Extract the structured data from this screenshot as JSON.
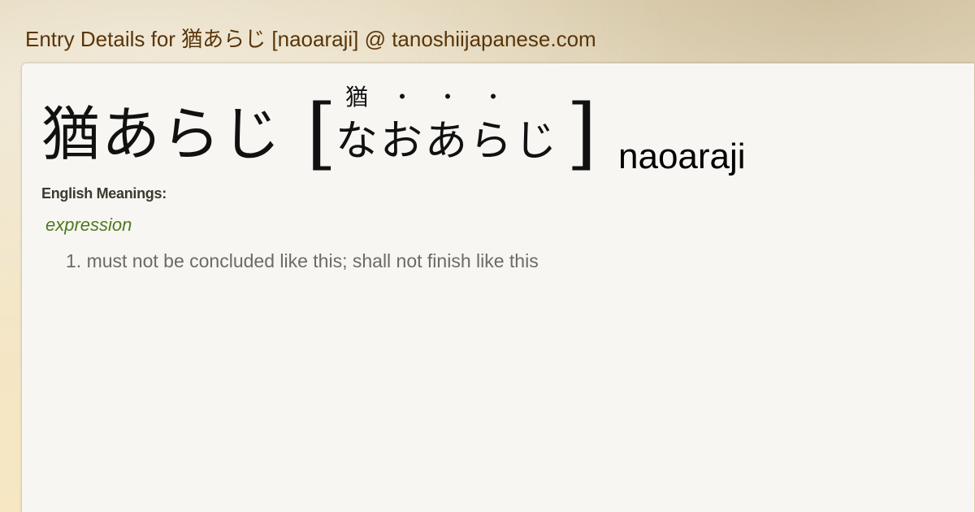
{
  "page": {
    "title": "Entry Details for 猶あらじ [naoaraji] @ tanoshiijapanese.com"
  },
  "entry": {
    "headword": "猶あらじ",
    "reading_kana": "なおあらじ",
    "furigana": [
      "猶",
      "・",
      "・",
      "・"
    ],
    "romaji": "naoaraji",
    "bracket_open": "[",
    "bracket_close": "]"
  },
  "meanings": {
    "label": "English Meanings:",
    "part_of_speech": "expression",
    "items": [
      "1. must not be concluded like this; shall not finish like this"
    ]
  },
  "colors": {
    "title": "#5a3508",
    "part_of_speech": "#4e7a1d",
    "meaning_text": "#6b6b66",
    "card_background": "#f7f6f2"
  }
}
